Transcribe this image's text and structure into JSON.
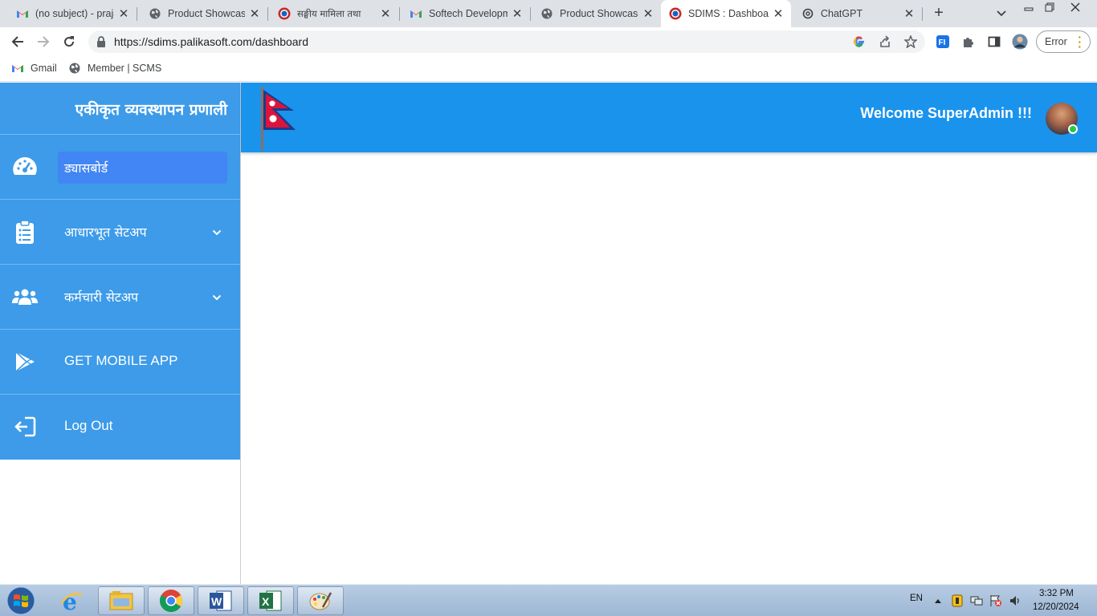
{
  "browser": {
    "tabs": [
      {
        "title": "(no subject) - praja",
        "icon": "gmail-icon"
      },
      {
        "title": "Product Showcase",
        "icon": "globe-icon"
      },
      {
        "title": "सङ्घीय मामिला तथा",
        "icon": "nepal-emblem-icon"
      },
      {
        "title": "Softech Developm",
        "icon": "gmail-icon"
      },
      {
        "title": "Product Showcase",
        "icon": "globe-icon"
      },
      {
        "title": "SDIMS : Dashboard",
        "icon": "nepal-emblem-icon",
        "active": true
      },
      {
        "title": "ChatGPT",
        "icon": "chatgpt-icon"
      }
    ],
    "new_tab": "+",
    "url": "https://sdims.palikasoft.com/dashboard",
    "error_label": "Error",
    "bookmarks": [
      {
        "label": "Gmail",
        "icon": "gmail-icon"
      },
      {
        "label": "Member | SCMS",
        "icon": "globe-icon"
      }
    ]
  },
  "sidebar": {
    "brand": "एकीकृत व्यवस्थापन प्रणाली",
    "items": [
      {
        "label": "ड्यासबोर्ड",
        "icon": "dashboard-gauge-icon",
        "active": true
      },
      {
        "label": "आधारभूत सेटअप",
        "icon": "clipboard-icon",
        "expandable": true
      },
      {
        "label": "कर्मचारी सेटअप",
        "icon": "users-icon",
        "expandable": true
      },
      {
        "label": "GET MOBILE APP",
        "icon": "play-store-icon"
      },
      {
        "label": "Log Out",
        "icon": "logout-icon"
      }
    ]
  },
  "header": {
    "welcome": "Welcome SuperAdmin !!!",
    "status": "online"
  },
  "colors": {
    "sidebar": "#3d9be9",
    "header": "#1a93ed",
    "active_item": "#4285f4"
  },
  "taskbar": {
    "apps": [
      "windows-explorer-icon",
      "internet-explorer-icon",
      "file-explorer-icon",
      "chrome-icon",
      "word-icon",
      "excel-icon",
      "paint-icon"
    ],
    "language": "EN",
    "time": "3:32 PM",
    "date": "12/20/2024"
  }
}
